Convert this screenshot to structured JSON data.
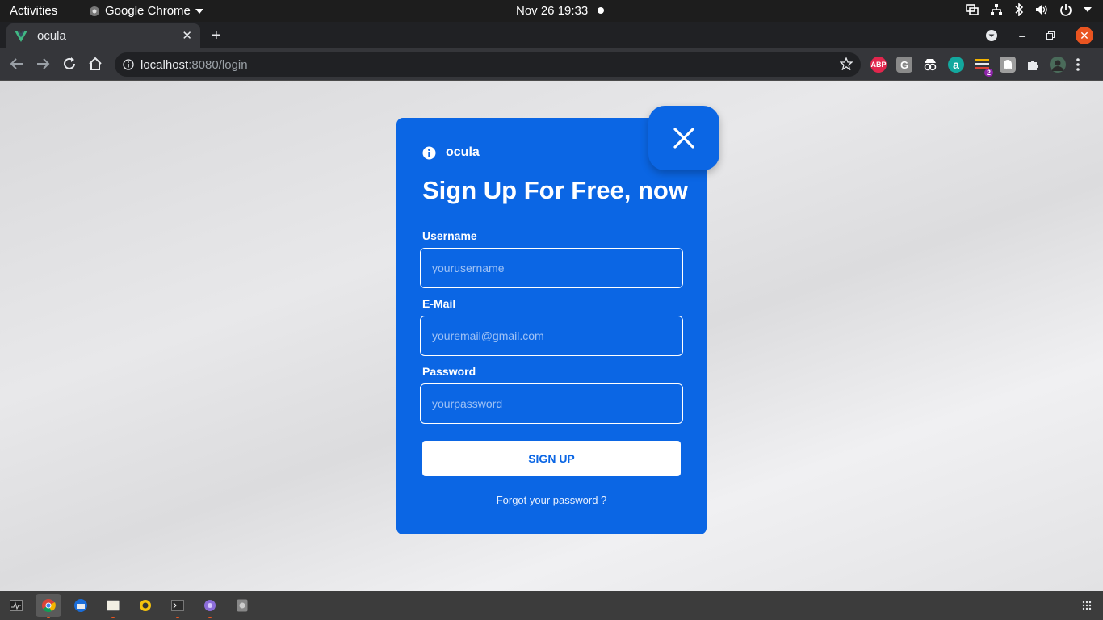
{
  "topbar": {
    "activities": "Activities",
    "app_name": "Google Chrome",
    "clock": "Nov 26  19:33"
  },
  "browser": {
    "tab_title": "ocula",
    "url_host": "localhost",
    "url_path": ":8080/login",
    "extension_badge": "2",
    "abp_label": "ABP",
    "g_label": "G",
    "a_label": "a"
  },
  "card": {
    "brand": "ocula",
    "title": "Sign Up For Free, now",
    "username_label": "Username",
    "username_placeholder": "yourusername",
    "email_label": "E-Mail",
    "email_placeholder": "youremail@gmail.com",
    "password_label": "Password",
    "password_placeholder": "yourpassword",
    "submit_label": "SIGN UP",
    "forgot_label": "Forgot your password ?",
    "accent_color": "#0b66e4"
  }
}
